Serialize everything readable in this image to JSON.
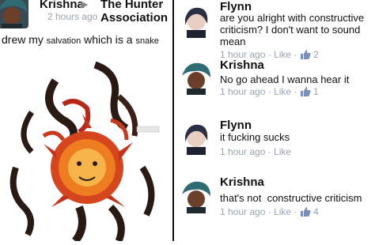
{
  "post": {
    "author": "Krishna",
    "group": "The Hunter Association",
    "timestamp": "2 hours ago",
    "text_part1": "drew my",
    "text_word": "salvation",
    "text_part2": "which is a",
    "text_word2": "snake"
  },
  "comments": [
    {
      "name": "Flynn",
      "text": "are you alright with constructive criticism? I don't want to sound mean",
      "time": "1 hour ago",
      "like_label": "Like",
      "likes": "2"
    },
    {
      "name": "Krishna",
      "text": "No go ahead I wanna hear it",
      "time": "1 hour ago",
      "like_label": "Like",
      "likes": "1"
    },
    {
      "name": "Flynn",
      "text": "it fucking sucks",
      "time": "1 hour ago",
      "like_label": "Like",
      "likes": ""
    },
    {
      "name": "Krishna",
      "text": "that's not  constructive criticism",
      "time": "1 hour ago",
      "like_label": "Like",
      "likes": "4"
    }
  ],
  "colors": {
    "meta": "#9aa3b2",
    "text": "#111111",
    "teal_hair": "#2f6b73"
  }
}
